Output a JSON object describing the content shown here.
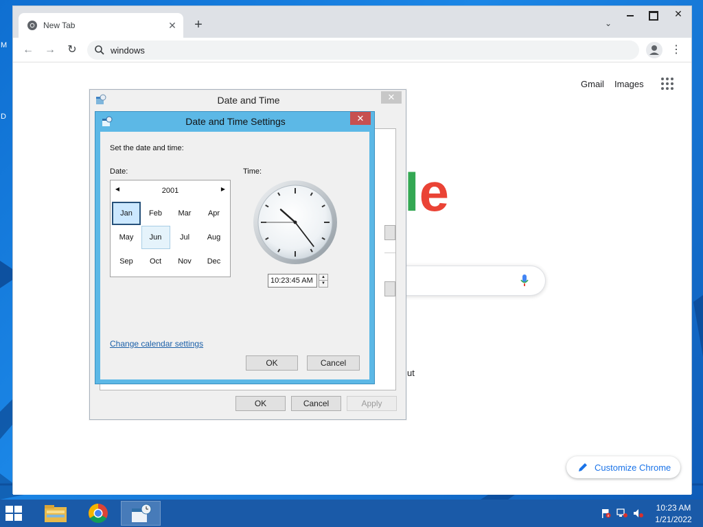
{
  "desktop": {
    "edge_letters": [
      "M",
      "D"
    ]
  },
  "browser": {
    "tab": {
      "title": "New Tab",
      "icon": "chrome-icon"
    },
    "omnibox": {
      "value": "windows",
      "icon": "search-icon"
    },
    "ntp": {
      "links": [
        "Gmail",
        "Images"
      ],
      "logo_fragment": [
        "l",
        "e"
      ],
      "logo_colors": {
        "l": "#34a853",
        "e": "#ea4335"
      },
      "shortcut_fragment": "ut",
      "customize_label": "Customize Chrome"
    }
  },
  "date_time_dialog": {
    "title": "Date and Time",
    "buttons": {
      "ok": "OK",
      "cancel": "Cancel",
      "apply": "Apply"
    }
  },
  "settings_dialog": {
    "title": "Date and Time Settings",
    "instruction": "Set the date and time:",
    "date_label": "Date:",
    "time_label": "Time:",
    "calendar": {
      "year": "2001",
      "months": [
        "Jan",
        "Feb",
        "Mar",
        "Apr",
        "May",
        "Jun",
        "Jul",
        "Aug",
        "Sep",
        "Oct",
        "Nov",
        "Dec"
      ],
      "selected": "Jan",
      "hovered": "Jun"
    },
    "time_value": "10:23:45 AM",
    "change_link": "Change calendar settings",
    "buttons": {
      "ok": "OK",
      "cancel": "Cancel"
    }
  },
  "taskbar": {
    "pinned": [
      "file-explorer-icon",
      "chrome-icon",
      "date-time-icon"
    ],
    "active": "date-time-icon",
    "clock": {
      "time": "10:23 AM",
      "date": "1/21/2022"
    }
  },
  "colors": {
    "dialog_title_active": "#5cb8e6",
    "close_button": "#c75050",
    "taskbar": "#1a5aa8",
    "link": "#1a5fa8"
  }
}
